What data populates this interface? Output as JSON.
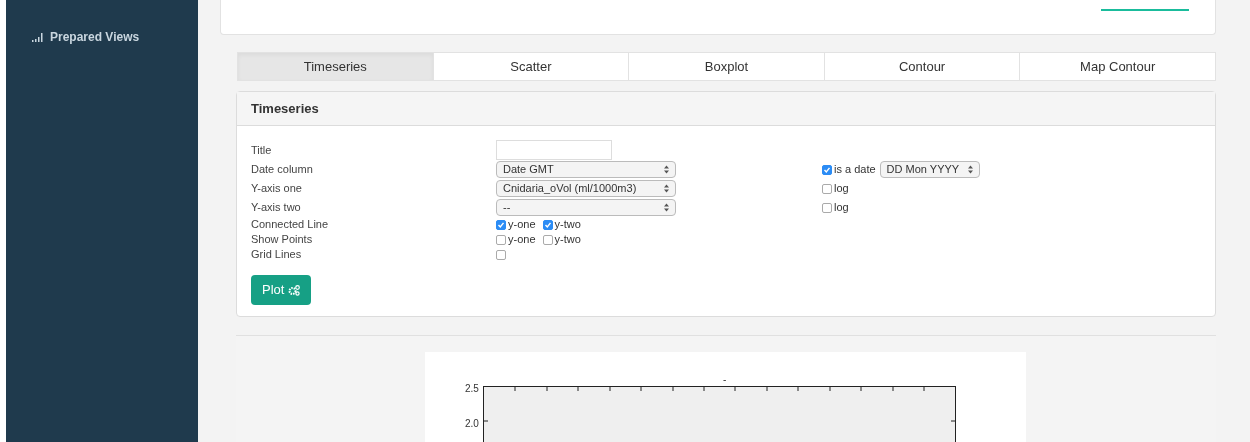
{
  "sidebar": {
    "items": [
      {
        "label": "Prepared Views"
      }
    ]
  },
  "tabs": [
    {
      "label": "Timeseries",
      "selected": true
    },
    {
      "label": "Scatter",
      "selected": false
    },
    {
      "label": "Boxplot",
      "selected": false
    },
    {
      "label": "Contour",
      "selected": false
    },
    {
      "label": "Map Contour",
      "selected": false
    }
  ],
  "panel": {
    "title": "Timeseries",
    "rows": [
      {
        "label": "Title",
        "kind": "text"
      },
      {
        "label": "Date column",
        "kind": "select",
        "value": "Date GMT",
        "extra": {
          "checked": true,
          "label": "is a date",
          "select": "DD Mon YYYY"
        }
      },
      {
        "label": "Y-axis one",
        "kind": "select",
        "value": "Cnidaria_oVol (ml/1000m3)",
        "extra": {
          "checked": false,
          "label": "log"
        }
      },
      {
        "label": "Y-axis two",
        "kind": "select",
        "value": "--",
        "extra": {
          "checked": false,
          "label": "log"
        }
      },
      {
        "label": "Connected Line",
        "kind": "checks",
        "options": [
          {
            "label": "y-one",
            "checked": true
          },
          {
            "label": "y-two",
            "checked": true
          }
        ]
      },
      {
        "label": "Show Points",
        "kind": "checks",
        "options": [
          {
            "label": "y-one",
            "checked": false
          },
          {
            "label": "y-two",
            "checked": false
          }
        ]
      },
      {
        "label": "Grid Lines",
        "kind": "check",
        "checked": false
      }
    ],
    "button": "Plot"
  },
  "plot": {
    "title": "-",
    "yticks": [
      "2.5",
      "2.0"
    ]
  }
}
